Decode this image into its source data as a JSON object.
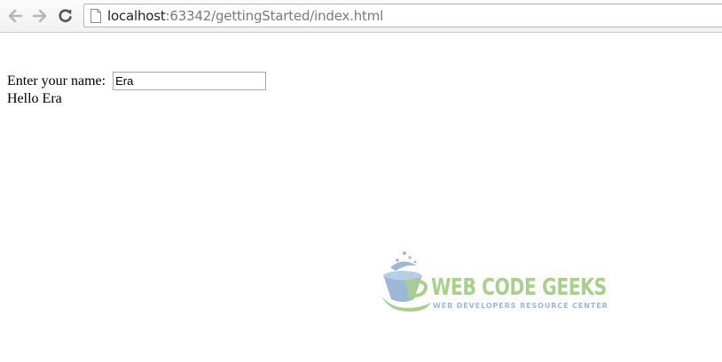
{
  "browser": {
    "url_host": "localhost",
    "url_rest": ":63342/gettingStarted/index.html",
    "icons": {
      "back": "arrow-left",
      "forward": "arrow-right",
      "reload": "reload",
      "page": "document"
    }
  },
  "page": {
    "name_label": "Enter your name: ",
    "name_value": "Era",
    "greeting": "Hello Era"
  },
  "watermark": {
    "title": "WEB CODE GEEKS",
    "subtitle": "WEB DEVELOPERS RESOURCE CENTER",
    "colors": {
      "green": "#a9cf8c",
      "blue": "#9cb8d6"
    }
  }
}
